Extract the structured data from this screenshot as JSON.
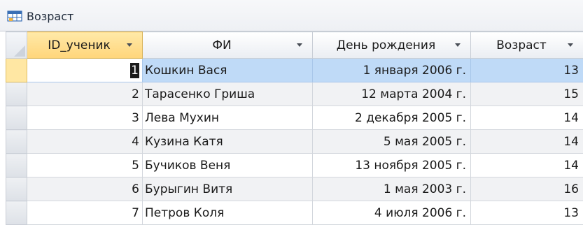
{
  "tab": {
    "title": "Возраст",
    "icon": "table-icon"
  },
  "columns": [
    {
      "key": "id",
      "label": "ID_ученик"
    },
    {
      "key": "name",
      "label": "ФИ"
    },
    {
      "key": "birth",
      "label": "День рождения"
    },
    {
      "key": "age",
      "label": "Возраст"
    }
  ],
  "rows": [
    {
      "id": "1",
      "name": "Кошкин Вася",
      "birth": "1 января 2006 г.",
      "age": "13"
    },
    {
      "id": "2",
      "name": "Тарасенко Гриша",
      "birth": "12 марта 2004 г.",
      "age": "15"
    },
    {
      "id": "3",
      "name": "Лева Мухин",
      "birth": "2 декабря 2005 г.",
      "age": "14"
    },
    {
      "id": "4",
      "name": "Кузина Катя",
      "birth": "5 мая 2005 г.",
      "age": "14"
    },
    {
      "id": "5",
      "name": "Бучиков Веня",
      "birth": "13 ноября 2005 г.",
      "age": "14"
    },
    {
      "id": "6",
      "name": "Бурыгин Витя",
      "birth": "1 мая 2003 г.",
      "age": "16"
    },
    {
      "id": "7",
      "name": "Петров Коля",
      "birth": "4 июля 2006 г.",
      "age": "13"
    }
  ],
  "colors": {
    "selected_row": "#bfdaf7",
    "active_header": "#ffd57a",
    "alt_row": "#f1f2f4"
  }
}
